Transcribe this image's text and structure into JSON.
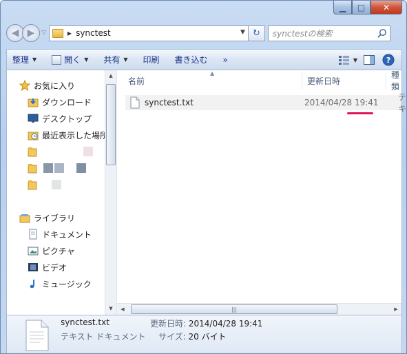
{
  "window": {
    "folder_name": "synctest",
    "search_placeholder": "synctestの検索"
  },
  "toolbar": {
    "organize": "整理",
    "open": "開く",
    "share": "共有",
    "print": "印刷",
    "burn": "書き込む",
    "more": "»"
  },
  "sidebar": {
    "favorites": "お気に入り",
    "downloads": "ダウンロード",
    "desktop": "デスクトップ",
    "recent": "最近表示した場所",
    "libraries": "ライブラリ",
    "documents": "ドキュメント",
    "pictures": "ピクチャ",
    "videos": "ビデオ",
    "music": "ミュージック"
  },
  "columns": {
    "name": "名前",
    "modified": "更新日時",
    "type": "種類"
  },
  "files": [
    {
      "name": "synctest.txt",
      "modified": "2014/04/28 19:41",
      "type": "テキ"
    }
  ],
  "details": {
    "file_name": "synctest.txt",
    "file_type": "テキスト ドキュメント",
    "modified_label": "更新日時:",
    "modified_value": "2014/04/28 19:41",
    "size_label": "サイズ:",
    "size_value": "20 バイト"
  },
  "colors": {
    "highlight_underline": "#e0125a",
    "close_button": "#c0391e"
  }
}
